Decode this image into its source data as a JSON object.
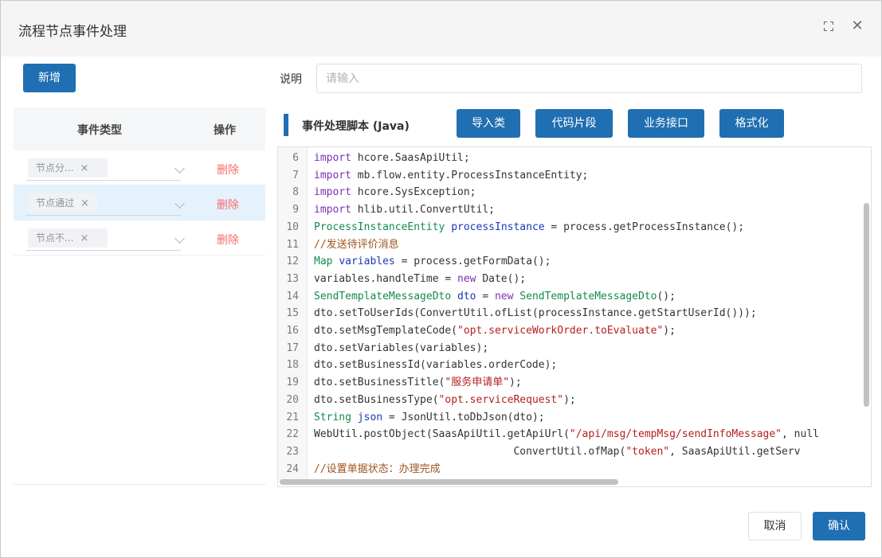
{
  "dialog": {
    "title": "流程节点事件处理"
  },
  "toolbar": {
    "add_label": "新增"
  },
  "table": {
    "headers": {
      "event_type": "事件类型",
      "operation": "操作"
    },
    "rows": [
      {
        "tag": "节点分...",
        "delete_label": "删除"
      },
      {
        "tag": "节点通过",
        "delete_label": "删除"
      },
      {
        "tag": "节点不...",
        "delete_label": "删除"
      }
    ]
  },
  "description": {
    "label": "说明",
    "placeholder": "请输入",
    "value": ""
  },
  "script": {
    "title": "事件处理脚本 (Java)",
    "buttons": {
      "import": "导入类",
      "snippet": "代码片段",
      "api": "业务接口",
      "format": "格式化"
    }
  },
  "code": {
    "lines": [
      {
        "n": "6",
        "tokens": [
          [
            "kw",
            "import"
          ],
          [
            "p",
            " hcore.SaasApiUtil;"
          ]
        ]
      },
      {
        "n": "7",
        "tokens": [
          [
            "kw",
            "import"
          ],
          [
            "p",
            " mb.flow.entity.ProcessInstanceEntity;"
          ]
        ]
      },
      {
        "n": "8",
        "tokens": [
          [
            "kw",
            "import"
          ],
          [
            "p",
            " hcore.SysException;"
          ]
        ]
      },
      {
        "n": "9",
        "tokens": [
          [
            "kw",
            "import"
          ],
          [
            "p",
            " hlib.util.ConvertUtil;"
          ]
        ]
      },
      {
        "n": "10",
        "tokens": [
          [
            "ty",
            "ProcessInstanceEntity"
          ],
          [
            "p",
            " "
          ],
          [
            "vr",
            "processInstance"
          ],
          [
            "p",
            " = process.getProcessInstance();"
          ]
        ]
      },
      {
        "n": "11",
        "tokens": [
          [
            "cm",
            "//发送待评价消息"
          ]
        ]
      },
      {
        "n": "12",
        "tokens": [
          [
            "ty",
            "Map"
          ],
          [
            "p",
            " "
          ],
          [
            "vr",
            "variables"
          ],
          [
            "p",
            " = process.getFormData();"
          ]
        ]
      },
      {
        "n": "13",
        "tokens": [
          [
            "p",
            "variables.handleTime = "
          ],
          [
            "kw",
            "new"
          ],
          [
            "p",
            " Date();"
          ]
        ]
      },
      {
        "n": "14",
        "tokens": [
          [
            "ty",
            "SendTemplateMessageDto"
          ],
          [
            "p",
            " "
          ],
          [
            "vr",
            "dto"
          ],
          [
            "p",
            " = "
          ],
          [
            "kw",
            "new"
          ],
          [
            "p",
            " "
          ],
          [
            "ty",
            "SendTemplateMessageDto"
          ],
          [
            "p",
            "();"
          ]
        ]
      },
      {
        "n": "15",
        "tokens": [
          [
            "p",
            "dto.setToUserIds(ConvertUtil.ofList(processInstance.getStartUserId()));"
          ]
        ]
      },
      {
        "n": "16",
        "tokens": [
          [
            "p",
            "dto.setMsgTemplateCode("
          ],
          [
            "st",
            "\"opt.serviceWorkOrder.toEvaluate\""
          ],
          [
            "p",
            ");"
          ]
        ]
      },
      {
        "n": "17",
        "tokens": [
          [
            "p",
            "dto.setVariables(variables);"
          ]
        ]
      },
      {
        "n": "18",
        "tokens": [
          [
            "p",
            "dto.setBusinessId(variables.orderCode);"
          ]
        ]
      },
      {
        "n": "19",
        "tokens": [
          [
            "p",
            "dto.setBusinessTitle("
          ],
          [
            "st",
            "\"服务申请单\""
          ],
          [
            "p",
            ");"
          ]
        ]
      },
      {
        "n": "20",
        "tokens": [
          [
            "p",
            "dto.setBusinessType("
          ],
          [
            "st",
            "\"opt.serviceRequest\""
          ],
          [
            "p",
            ");"
          ]
        ]
      },
      {
        "n": "21",
        "tokens": [
          [
            "ty",
            "String"
          ],
          [
            "p",
            " "
          ],
          [
            "vr",
            "json"
          ],
          [
            "p",
            " = JsonUtil.toDbJson(dto);"
          ]
        ]
      },
      {
        "n": "22",
        "tokens": [
          [
            "p",
            "WebUtil.postObject(SaasApiUtil.getApiUrl("
          ],
          [
            "st",
            "\"/api/msg/tempMsg/sendInfoMessage\""
          ],
          [
            "p",
            ", null"
          ]
        ]
      },
      {
        "n": "23",
        "tokens": [
          [
            "p",
            "                                ConvertUtil.ofMap("
          ],
          [
            "st",
            "\"token\""
          ],
          [
            "p",
            ", SaasApiUtil.getServ"
          ]
        ]
      },
      {
        "n": "24",
        "tokens": [
          [
            "cm",
            "//设置单据状态：办理完成"
          ]
        ]
      }
    ]
  },
  "footer": {
    "cancel_label": "取消",
    "ok_label": "确认"
  },
  "icons": {
    "maximize": "maximize-icon",
    "close": "close-icon"
  },
  "colors": {
    "primary": "#1f6fb2",
    "danger": "#f56c6c"
  }
}
